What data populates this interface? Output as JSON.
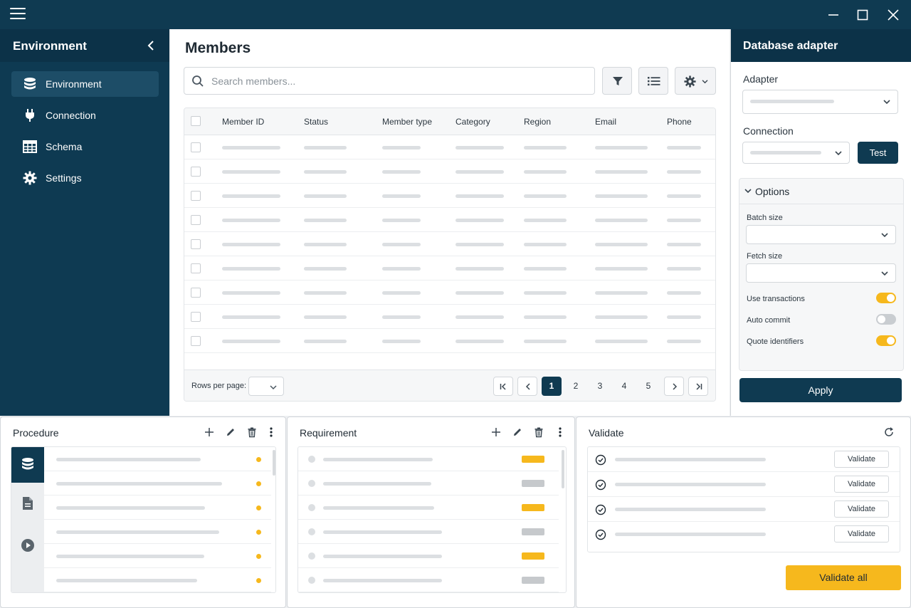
{
  "sidebar": {
    "title": "Environment",
    "items": [
      {
        "label": "Environment",
        "icon": "database-icon",
        "active": true
      },
      {
        "label": "Connection",
        "icon": "plug-icon",
        "active": false
      },
      {
        "label": "Schema",
        "icon": "table-icon",
        "active": false
      },
      {
        "label": "Settings",
        "icon": "gear-icon",
        "active": false
      }
    ]
  },
  "main": {
    "title": "Members",
    "search_placeholder": "Search members...",
    "columns": [
      "Member ID",
      "Status",
      "Member type",
      "Category",
      "Region",
      "Email",
      "Phone"
    ],
    "row_count": 9,
    "footer": {
      "rows_per_page_label": "Rows per page:",
      "pages": [
        "1",
        "2",
        "3",
        "4",
        "5"
      ],
      "current_page": "1"
    }
  },
  "right_panel": {
    "title": "Database adapter",
    "adapter_label": "Adapter",
    "connection_label": "Connection",
    "test_label": "Test",
    "options_title": "Options",
    "batch_size_label": "Batch size",
    "fetch_size_label": "Fetch size",
    "toggles": [
      {
        "label": "Use transactions",
        "on": true
      },
      {
        "label": "Auto commit",
        "on": false
      },
      {
        "label": "Quote identifiers",
        "on": true
      }
    ],
    "apply_label": "Apply"
  },
  "procedure": {
    "title": "Procedure",
    "tabs": [
      "database-icon",
      "document-icon",
      "play-icon"
    ]
  },
  "requirement": {
    "title": "Requirement",
    "badges": [
      "amber",
      "gray",
      "amber",
      "gray",
      "amber",
      "gray"
    ]
  },
  "validate": {
    "title": "Validate",
    "button_label": "Validate",
    "rows": 4,
    "validate_all_label": "Validate all"
  },
  "colors": {
    "navy": "#0f3a51",
    "accent": "#f6b81d",
    "toggle_off": "#c9cdd1",
    "placeholder": "#dcdfe2"
  }
}
